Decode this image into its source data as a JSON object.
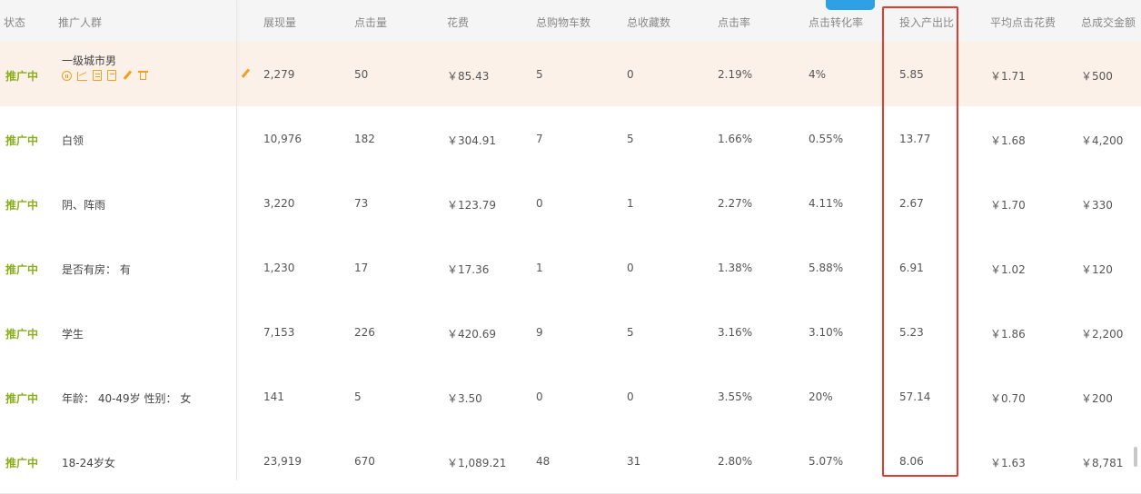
{
  "columns": [
    "状态",
    "推广人群",
    "展现量",
    "点击量",
    "花费",
    "总购物车数",
    "总收藏数",
    "点击率",
    "点击转化率",
    "投入产出比",
    "平均点击花费",
    "总成交金额"
  ],
  "rows": [
    {
      "status": "推广中",
      "name": "一级城市男",
      "impressions": "2,279",
      "clicks": "50",
      "cost": "￥85.43",
      "carts": "5",
      "favs": "0",
      "ctr": "2.19%",
      "cvr": "4%",
      "roi": "5.85",
      "cpc": "￥1.71",
      "gmv": "￥500"
    },
    {
      "status": "推广中",
      "name": "白领",
      "impressions": "10,976",
      "clicks": "182",
      "cost": "￥304.91",
      "carts": "7",
      "favs": "5",
      "ctr": "1.66%",
      "cvr": "0.55%",
      "roi": "13.77",
      "cpc": "￥1.68",
      "gmv": "￥4,200"
    },
    {
      "status": "推广中",
      "name": "阴、阵雨",
      "impressions": "3,220",
      "clicks": "73",
      "cost": "￥123.79",
      "carts": "0",
      "favs": "1",
      "ctr": "2.27%",
      "cvr": "4.11%",
      "roi": "2.67",
      "cpc": "￥1.70",
      "gmv": "￥330"
    },
    {
      "status": "推广中",
      "name": "是否有房： 有",
      "impressions": "1,230",
      "clicks": "17",
      "cost": "￥17.36",
      "carts": "1",
      "favs": "0",
      "ctr": "1.38%",
      "cvr": "5.88%",
      "roi": "6.91",
      "cpc": "￥1.02",
      "gmv": "￥120"
    },
    {
      "status": "推广中",
      "name": "学生",
      "impressions": "7,153",
      "clicks": "226",
      "cost": "￥420.69",
      "carts": "9",
      "favs": "5",
      "ctr": "3.16%",
      "cvr": "3.10%",
      "roi": "5.23",
      "cpc": "￥1.86",
      "gmv": "￥2,200"
    },
    {
      "status": "推广中",
      "name": "年龄： 40-49岁 性别： 女",
      "impressions": "141",
      "clicks": "5",
      "cost": "￥3.50",
      "carts": "0",
      "favs": "0",
      "ctr": "3.55%",
      "cvr": "20%",
      "roi": "57.14",
      "cpc": "￥0.70",
      "gmv": "￥200"
    },
    {
      "status": "推广中",
      "name": "18-24岁女",
      "impressions": "23,919",
      "clicks": "670",
      "cost": "￥1,089.21",
      "carts": "48",
      "favs": "31",
      "ctr": "2.80%",
      "cvr": "5.07%",
      "roi": "8.06",
      "cpc": "￥1.63",
      "gmv": "￥8,781"
    }
  ],
  "colors": {
    "status": "#8aad1c",
    "highlight_row": "#fbf1e9",
    "icon": "#f0a020",
    "redbox": "#e53a2f",
    "top_button": "#2ea0e6"
  },
  "row_actions": [
    "pause-icon",
    "chart-icon",
    "report-icon",
    "note-icon",
    "edit-icon",
    "delete-icon"
  ]
}
